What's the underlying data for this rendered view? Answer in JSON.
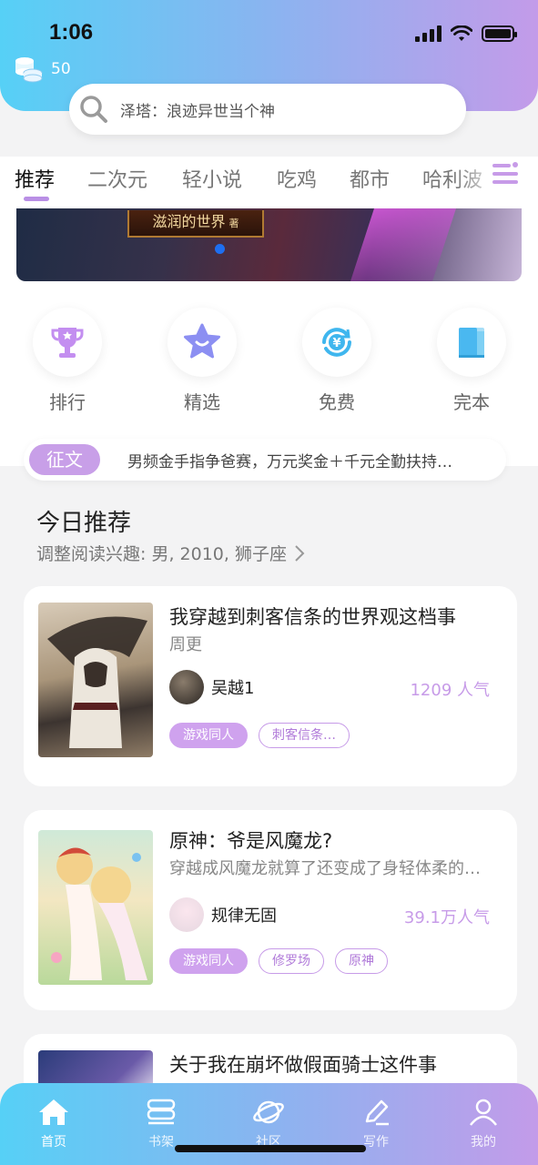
{
  "status_bar": {
    "time": "1:06"
  },
  "coins": {
    "count": "50"
  },
  "search": {
    "placeholder": "泽塔：浪迹异世当个神"
  },
  "tabs": [
    {
      "label": "推荐",
      "active": true
    },
    {
      "label": "二次元"
    },
    {
      "label": "轻小说"
    },
    {
      "label": "吃鸡"
    },
    {
      "label": "都市"
    },
    {
      "label": "哈利波"
    }
  ],
  "banner": {
    "title": "滋润的世界",
    "badge": "著"
  },
  "quick_links": [
    {
      "label": "排行",
      "icon": "trophy-icon",
      "color": "#c38ef0"
    },
    {
      "label": "精选",
      "icon": "star-icon",
      "color": "#8c8ff2"
    },
    {
      "label": "免费",
      "icon": "yuan-refresh-icon",
      "color": "#3fb6ee"
    },
    {
      "label": "完本",
      "icon": "book-icon",
      "color": "#4ab8f0"
    }
  ],
  "notice": {
    "badge": "征文",
    "text": "男频金手指争爸赛，万元奖金＋千元全勤扶持…"
  },
  "today": {
    "title": "今日推荐",
    "subtitle": "调整阅读兴趣: 男, 2010, 狮子座"
  },
  "books": [
    {
      "title": "我穿越到刺客信条的世界观这档事",
      "desc": "周更",
      "author": "吴越1",
      "popularity": "1209 人气",
      "tags": [
        "游戏同人",
        "刺客信条…"
      ]
    },
    {
      "title": "原神：爷是风魔龙?",
      "desc": "穿越成风魔龙就算了还变成了身轻体柔的…",
      "author": "规律无固",
      "popularity": "39.1万人气",
      "tags": [
        "游戏同人",
        "修罗场",
        "原神"
      ]
    },
    {
      "title": "关于我在崩坏做假面骑士这件事",
      "desc": "",
      "author": "",
      "popularity": "",
      "tags": []
    }
  ],
  "bottom_nav": [
    {
      "label": "首页",
      "icon": "home-icon",
      "active": true
    },
    {
      "label": "书架",
      "icon": "bookshelf-icon"
    },
    {
      "label": "社区",
      "icon": "planet-icon"
    },
    {
      "label": "写作",
      "icon": "pen-icon"
    },
    {
      "label": "我的",
      "icon": "user-icon"
    }
  ],
  "colors": {
    "accent": "#c79be8",
    "gradient_start": "#56d0f6",
    "gradient_end": "#c39be9"
  }
}
